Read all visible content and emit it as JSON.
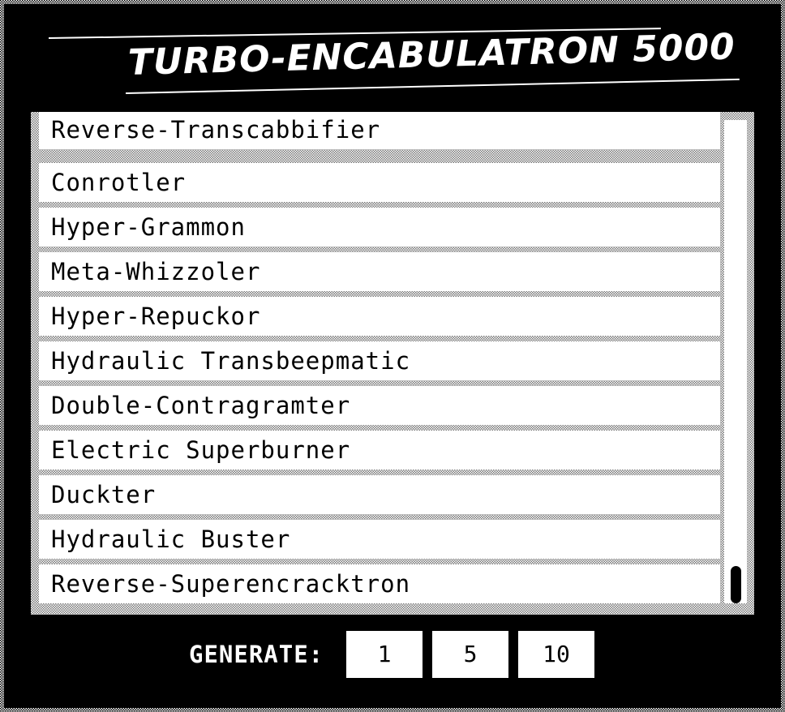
{
  "app": {
    "title": "TURBO-ENCABULATRON 5000"
  },
  "list": {
    "items": [
      "Reverse-Transcabbifier",
      "Conrotler",
      "Hyper-Grammon",
      "Meta-Whizzoler",
      "Hyper-Repuckor",
      "Hydraulic Transbeepmatic",
      "Double-Contragramter",
      "Electric Superburner",
      "Duckter",
      "Hydraulic Buster",
      "Reverse-Superencracktron"
    ]
  },
  "scroll": {
    "position_fraction": 1.0
  },
  "generate": {
    "label": "GENERATE:",
    "buttons": [
      "1",
      "5",
      "10"
    ]
  },
  "colors": {
    "background": "#000000",
    "foreground": "#ffffff"
  }
}
